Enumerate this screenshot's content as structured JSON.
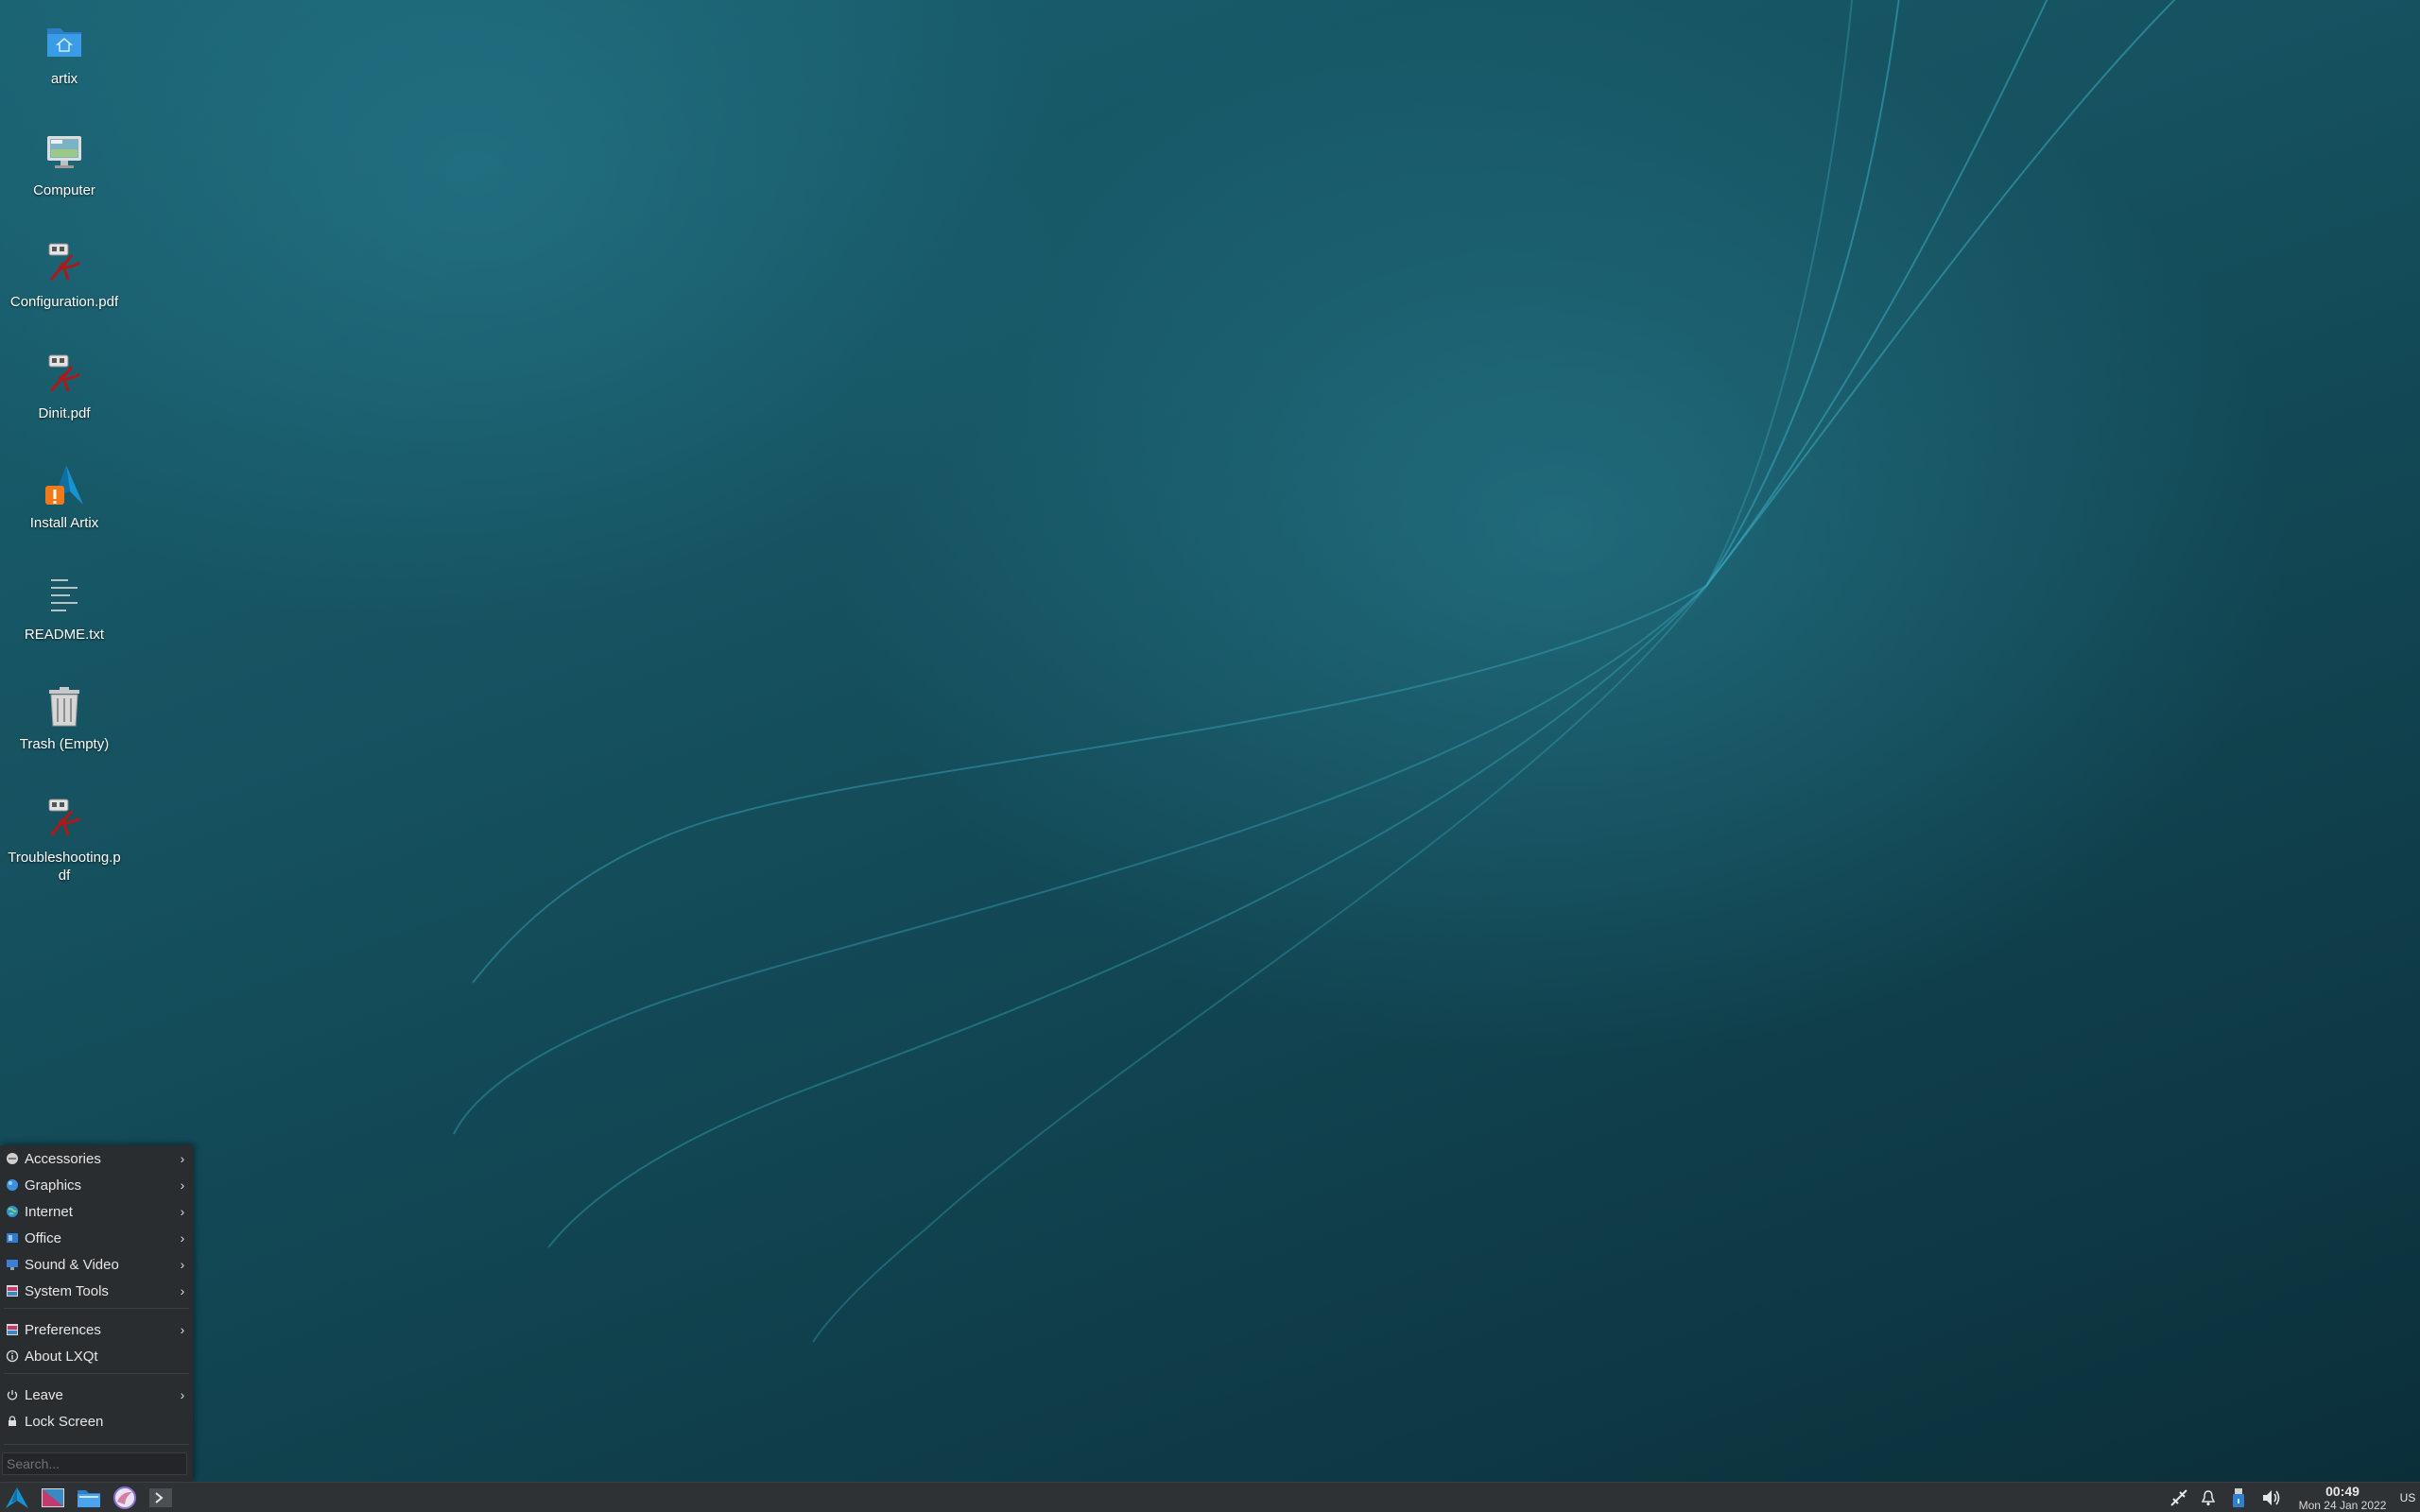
{
  "desktop": {
    "icons": [
      {
        "label": "artix",
        "icon": "home-folder-icon"
      },
      {
        "label": "Computer",
        "icon": "computer-icon"
      },
      {
        "label": "Configuration.pdf",
        "icon": "pdf-icon"
      },
      {
        "label": "Dinit.pdf",
        "icon": "pdf-icon"
      },
      {
        "label": "Install Artix",
        "icon": "installer-icon"
      },
      {
        "label": "README.txt",
        "icon": "text-file-icon"
      },
      {
        "label": "Trash (Empty)",
        "icon": "trash-icon"
      },
      {
        "label": "Troubleshooting.pdf",
        "icon": "pdf-icon"
      }
    ]
  },
  "start_menu": {
    "items": [
      {
        "label": "Accessories",
        "icon": "accessories-icon",
        "submenu": true
      },
      {
        "label": "Graphics",
        "icon": "graphics-icon",
        "submenu": true
      },
      {
        "label": "Internet",
        "icon": "internet-icon",
        "submenu": true
      },
      {
        "label": "Office",
        "icon": "office-icon",
        "submenu": true
      },
      {
        "label": "Sound & Video",
        "icon": "sound-video-icon",
        "submenu": true
      },
      {
        "label": "System Tools",
        "icon": "system-tools-icon",
        "submenu": true
      },
      {
        "label": "Preferences",
        "icon": "preferences-icon",
        "submenu": true
      },
      {
        "label": "About LXQt",
        "icon": "info-icon",
        "submenu": false
      },
      {
        "label": "Leave",
        "icon": "power-icon",
        "submenu": true
      },
      {
        "label": "Lock Screen",
        "icon": "lock-icon",
        "submenu": false
      }
    ],
    "search_placeholder": "Search..."
  },
  "taskbar": {
    "launchers": [
      "artix-menu-icon",
      "settings-launcher-icon",
      "file-manager-icon",
      "browser-icon",
      "terminal-icon"
    ],
    "tray": [
      "network-icon",
      "notification-bell-icon",
      "usb-device-icon",
      "volume-icon"
    ],
    "clock": {
      "time": "00:49",
      "date": "Mon 24 Jan 2022"
    },
    "keyboard_layout": "US"
  },
  "colors": {
    "accent": "#1793d1",
    "menu_bg": "#2a2d30",
    "taskbar_bg": "#2f3235"
  }
}
